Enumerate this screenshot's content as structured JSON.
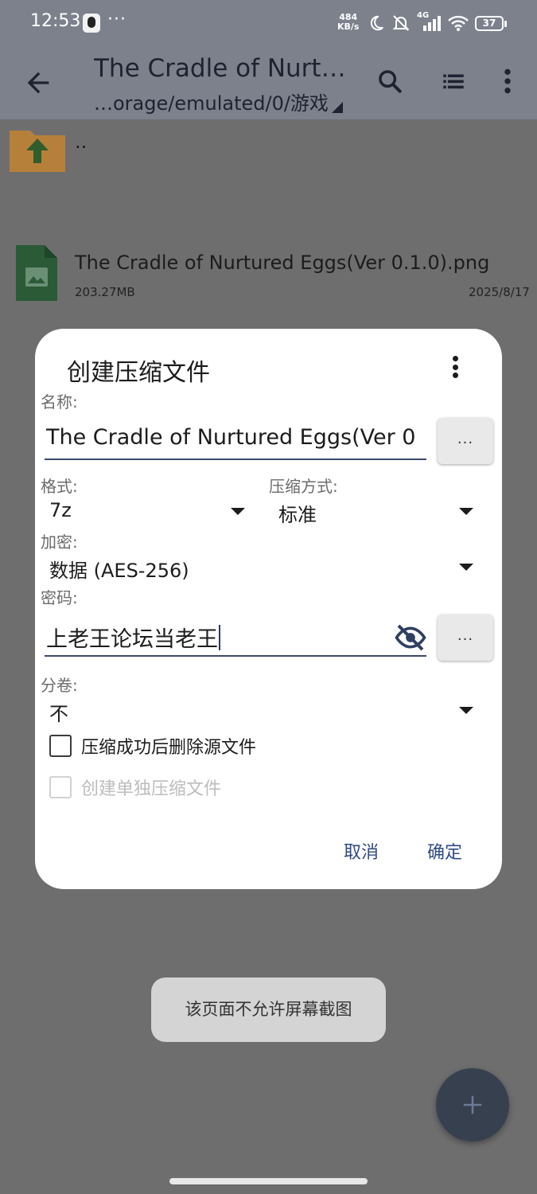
{
  "status_bar": {
    "time": "12:53",
    "dots": "···",
    "net_speed_value": "484",
    "net_speed_unit": "KB/s",
    "network": "4G",
    "battery": "37"
  },
  "toolbar": {
    "title": "The Cradle of Nurt…",
    "path": "…orage/emulated/0/游戏"
  },
  "files": [
    {
      "name": "..",
      "icon": "folder-up-icon"
    },
    {
      "name": "The Cradle of Nurtured Eggs(Ver 0.1.0).png",
      "size": "203.27MB",
      "date": "2025/8/17",
      "icon": "image-file-icon"
    }
  ],
  "dialog": {
    "title": "创建压缩文件",
    "name_label": "名称:",
    "name_value": "The Cradle of Nurtured Eggs(Ver 0",
    "browse_label": "...",
    "format_label": "格式:",
    "format_value": "7z",
    "compression_label": "压缩方式:",
    "compression_value": "标准",
    "encryption_label": "加密:",
    "encryption_value": "数据 (AES-256)",
    "password_label": "密码:",
    "password_value": "上老王论坛当老王",
    "password_more_label": "...",
    "split_label": "分卷:",
    "split_value": "不",
    "delete_source_label": "压缩成功后删除源文件",
    "separate_archives_label": "创建单独压缩文件",
    "cancel_label": "取消",
    "ok_label": "确定"
  },
  "toast": "该页面不允许屏幕截图",
  "colors": {
    "accent": "#2f4a86",
    "scrim_background": "#6e6e6e",
    "fab": "#37404f"
  }
}
